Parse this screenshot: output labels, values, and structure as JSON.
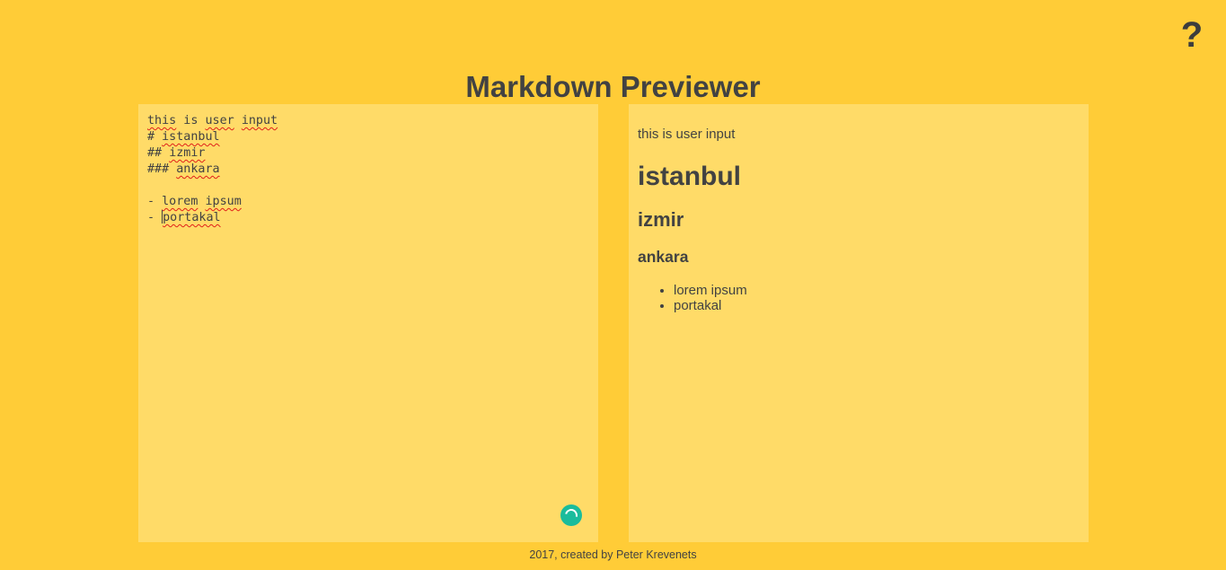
{
  "help_icon": {
    "glyph": "?",
    "icon": "question-mark-icon"
  },
  "header": {
    "title": "Markdown Previewer"
  },
  "editor": {
    "lines": [
      [
        {
          "t": "this",
          "sp": true
        },
        {
          "t": " is "
        },
        {
          "t": "user",
          "sp": true
        },
        {
          "t": " "
        },
        {
          "t": "input",
          "sp": true
        }
      ],
      [
        {
          "t": "# "
        },
        {
          "t": "istanbul",
          "sp": true
        }
      ],
      [
        {
          "t": "## "
        },
        {
          "t": "izmir",
          "sp": true
        }
      ],
      [
        {
          "t": "### "
        },
        {
          "t": "ankara",
          "sp": true
        }
      ],
      [],
      [
        {
          "t": "- "
        },
        {
          "t": "lorem",
          "sp": true
        },
        {
          "t": " "
        },
        {
          "t": "ipsum",
          "sp": true
        }
      ],
      [
        {
          "t": "- "
        },
        {
          "cursor": true
        },
        {
          "t": "portakal",
          "sp": true
        }
      ]
    ]
  },
  "preview": {
    "paragraph": "this is user input",
    "h1": "istanbul",
    "h2": "izmir",
    "h3": "ankara",
    "list": [
      "lorem ipsum",
      "portakal"
    ]
  },
  "footer": {
    "text": "2017, created by Peter Krevenets"
  },
  "colors": {
    "background": "#ffcc37",
    "panel": "#ffdb68",
    "text": "#424242",
    "spinner": "#1abc9c",
    "spellcheck": "#e0201a"
  }
}
